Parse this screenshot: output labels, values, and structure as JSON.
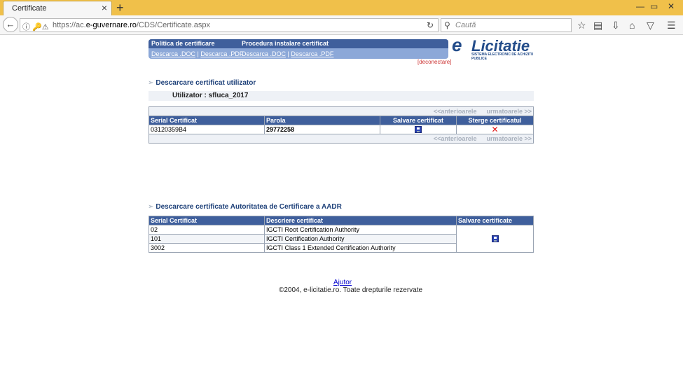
{
  "browser": {
    "tab_title": "Certificate",
    "tab_close": "×",
    "new_tab": "+",
    "url_prefix": "https://ac.",
    "url_domain": "e-guvernare.ro",
    "url_path": "/CDS/Certificate.aspx",
    "search_placeholder": "Caută",
    "window_buttons": [
      "—",
      "▭",
      "✕"
    ]
  },
  "header": {
    "col1_title": "Politica de certificare",
    "col2_title": "Procedura instalare certificat",
    "col1_links": [
      "Descarca .DOC",
      "Descarca .PDF"
    ],
    "col2_links": [
      "Descarca .DOC",
      "Descarca .PDF"
    ],
    "logout": "[deconectare]"
  },
  "logo": {
    "e": "e",
    "text": "Licitatie",
    "subtitle": "SISTEMA ELECTRONIC DE ACHIZITII PUBLICE"
  },
  "user_section": {
    "title": "Descarcare certificat utilizator",
    "user_label": "Utilizator : sfluca_2017",
    "pager_prev": "<<anterioarele",
    "pager_next": "urmatoarele >>",
    "columns": [
      "Serial Certificat",
      "Parola",
      "Salvare certificat",
      "Sterge certificatul"
    ],
    "rows": [
      {
        "serial": "03120359B4",
        "password": "29772258"
      }
    ]
  },
  "ca_section": {
    "title": "Descarcare certificate Autoritatea de Certificare a AADR",
    "columns": [
      "Serial Certificat",
      "Descriere certificat",
      "Salvare certificate"
    ],
    "rows": [
      {
        "serial": "02",
        "description": "IGCTI Root Certification Authority"
      },
      {
        "serial": "101",
        "description": "IGCTI Certification Authority"
      },
      {
        "serial": "3002",
        "description": "IGCTI Class 1 Extended Certification Authority"
      }
    ]
  },
  "footer": {
    "help": "Ajutor",
    "copyright": "©2004, e-licitatie.ro. Toate drepturile rezervate"
  }
}
